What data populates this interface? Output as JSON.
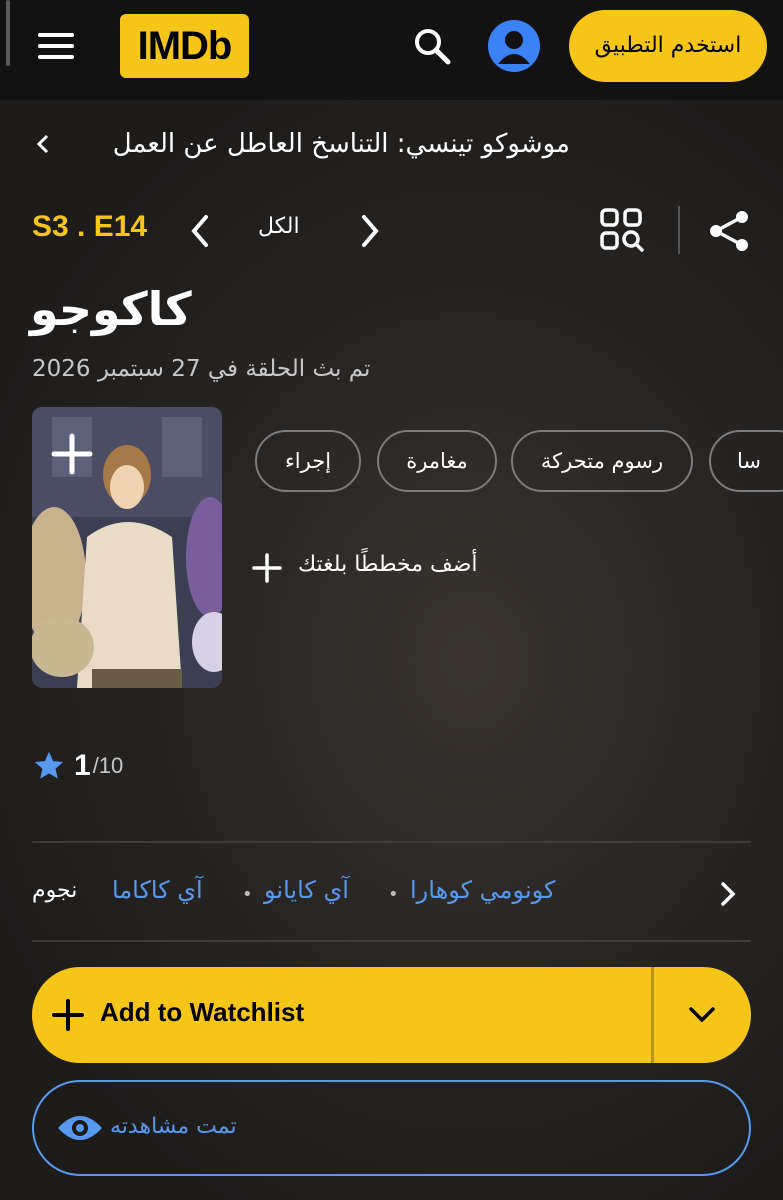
{
  "header": {
    "logo_text": "IMDb",
    "app_button_label": "استخدم التطبيق",
    "icons": [
      "menu-icon",
      "search-icon",
      "user-icon"
    ]
  },
  "breadcrumb": {
    "text": "موشوكو تينسي: التناسخ العاطل عن العمل"
  },
  "episode_nav": {
    "code": "S3 . E14",
    "all_label": "الكل",
    "icons": [
      "chevron-left-icon",
      "chevron-right-icon",
      "episode-grid-search-icon",
      "share-icon"
    ]
  },
  "episode": {
    "title": "كاكوجو",
    "air_date": "تم بث الحلقة في 27 سبتمبر 2026"
  },
  "genres": [
    "إجراء",
    "مغامرة",
    "رسوم متحركة",
    "سا"
  ],
  "plot": {
    "add_label": "أضف مخططًا بلغتك"
  },
  "rating": {
    "value": "1",
    "max": "/10"
  },
  "stars": {
    "label": "نجوم",
    "names": [
      "آي كاكاما",
      "آي كايانو",
      "كونومي كوهارا"
    ]
  },
  "watchlist": {
    "label": "Add to Watchlist"
  },
  "watched": {
    "label": "تمت مشاهدته"
  },
  "colors": {
    "accent": "#f5c518",
    "link": "#5799ef",
    "background": "#1c1b1a"
  }
}
